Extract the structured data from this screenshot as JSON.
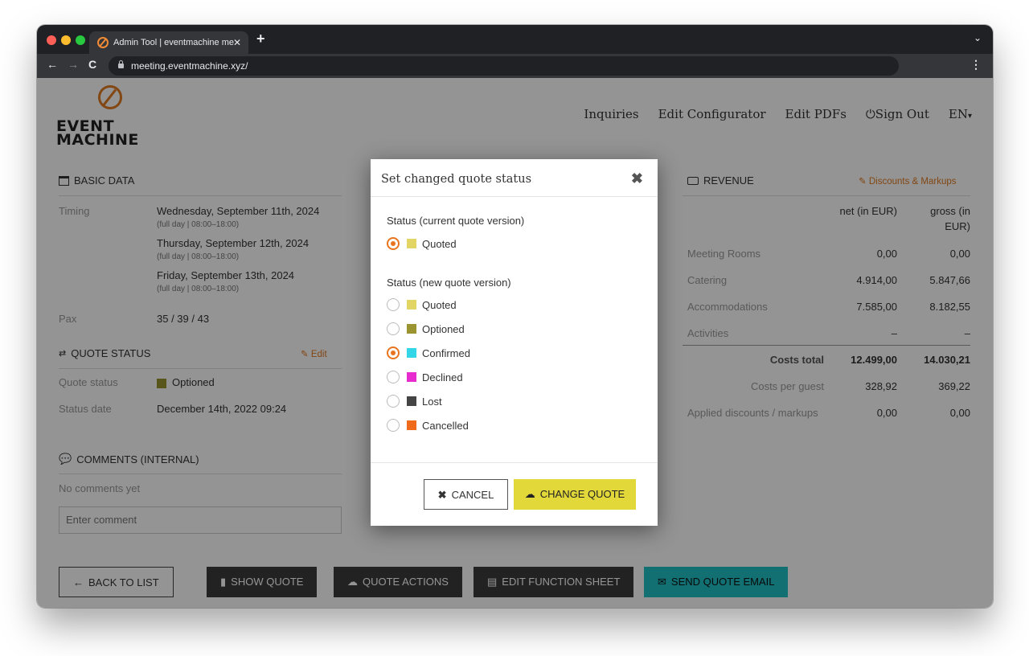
{
  "browser": {
    "tab_title": "Admin Tool | eventmachine me",
    "url": "meeting.eventmachine.xyz/",
    "traffic_colors": [
      "#ff5f57",
      "#febc2e",
      "#28c840"
    ]
  },
  "brand": {
    "line1": "EVENT",
    "line2": "MACHINE",
    "accent": "#e07a22"
  },
  "nav": {
    "inquiries": "Inquiries",
    "edit_configurator": "Edit Configurator",
    "edit_pdfs": "Edit PDFs",
    "sign_out": "Sign Out",
    "language": "EN"
  },
  "basic_data": {
    "header": "BASIC DATA",
    "timing_label": "Timing",
    "dates": [
      {
        "date": "Wednesday, September 11th, 2024",
        "detail": "(full day | 08:00–18:00)"
      },
      {
        "date": "Thursday, September 12th, 2024",
        "detail": "(full day | 08:00–18:00)"
      },
      {
        "date": "Friday, September 13th, 2024",
        "detail": "(full day | 08:00–18:00)"
      }
    ],
    "pax_label": "Pax",
    "pax_value": "35 / 39 / 43"
  },
  "quote_status": {
    "header": "QUOTE STATUS",
    "edit": "Edit",
    "status_label": "Quote status",
    "status_value": "Optioned",
    "status_color": "#9a9531",
    "date_label": "Status date",
    "date_value": "December 14th, 2022 09:24"
  },
  "comments": {
    "header": "COMMENTS (INTERNAL)",
    "empty": "No comments yet",
    "placeholder": "Enter comment"
  },
  "revenue": {
    "header": "REVENUE",
    "discounts_link": "Discounts & Markups",
    "col_net": "net (in EUR)",
    "col_gross_1": "gross (in",
    "col_gross_2": "EUR)",
    "rows": [
      {
        "label": "Meeting Rooms",
        "net": "0,00",
        "gross": "0,00"
      },
      {
        "label": "Catering",
        "net": "4.914,00",
        "gross": "5.847,66"
      },
      {
        "label": "Accommodations",
        "net": "7.585,00",
        "gross": "8.182,55"
      },
      {
        "label": "Activities",
        "net": "–",
        "gross": "–"
      }
    ],
    "total_label": "Costs total",
    "total_net": "12.499,00",
    "total_gross": "14.030,21",
    "per_guest_label": "Costs per guest",
    "per_guest_net": "328,92",
    "per_guest_gross": "369,22",
    "applied_label": "Applied discounts / markups",
    "applied_net": "0,00",
    "applied_gross": "0,00"
  },
  "actions": {
    "back": "BACK TO LIST",
    "show_quote": "SHOW QUOTE",
    "quote_actions": "QUOTE ACTIONS",
    "edit_function_sheet": "EDIT FUNCTION SHEET",
    "send_email": "SEND QUOTE EMAIL"
  },
  "modal": {
    "title": "Set changed quote status",
    "current_label": "Status (current quote version)",
    "current_option": {
      "label": "Quoted",
      "color": "#e2d564",
      "selected": true
    },
    "new_label": "Status (new quote version)",
    "new_options": [
      {
        "label": "Quoted",
        "color": "#e2d564",
        "selected": false
      },
      {
        "label": "Optioned",
        "color": "#9a9531",
        "selected": false
      },
      {
        "label": "Confirmed",
        "color": "#33d6e6",
        "selected": true
      },
      {
        "label": "Declined",
        "color": "#e82bcf",
        "selected": false
      },
      {
        "label": "Lost",
        "color": "#444444",
        "selected": false
      },
      {
        "label": "Cancelled",
        "color": "#f06a1c",
        "selected": false
      }
    ],
    "cancel": "CANCEL",
    "change": "CHANGE QUOTE"
  }
}
